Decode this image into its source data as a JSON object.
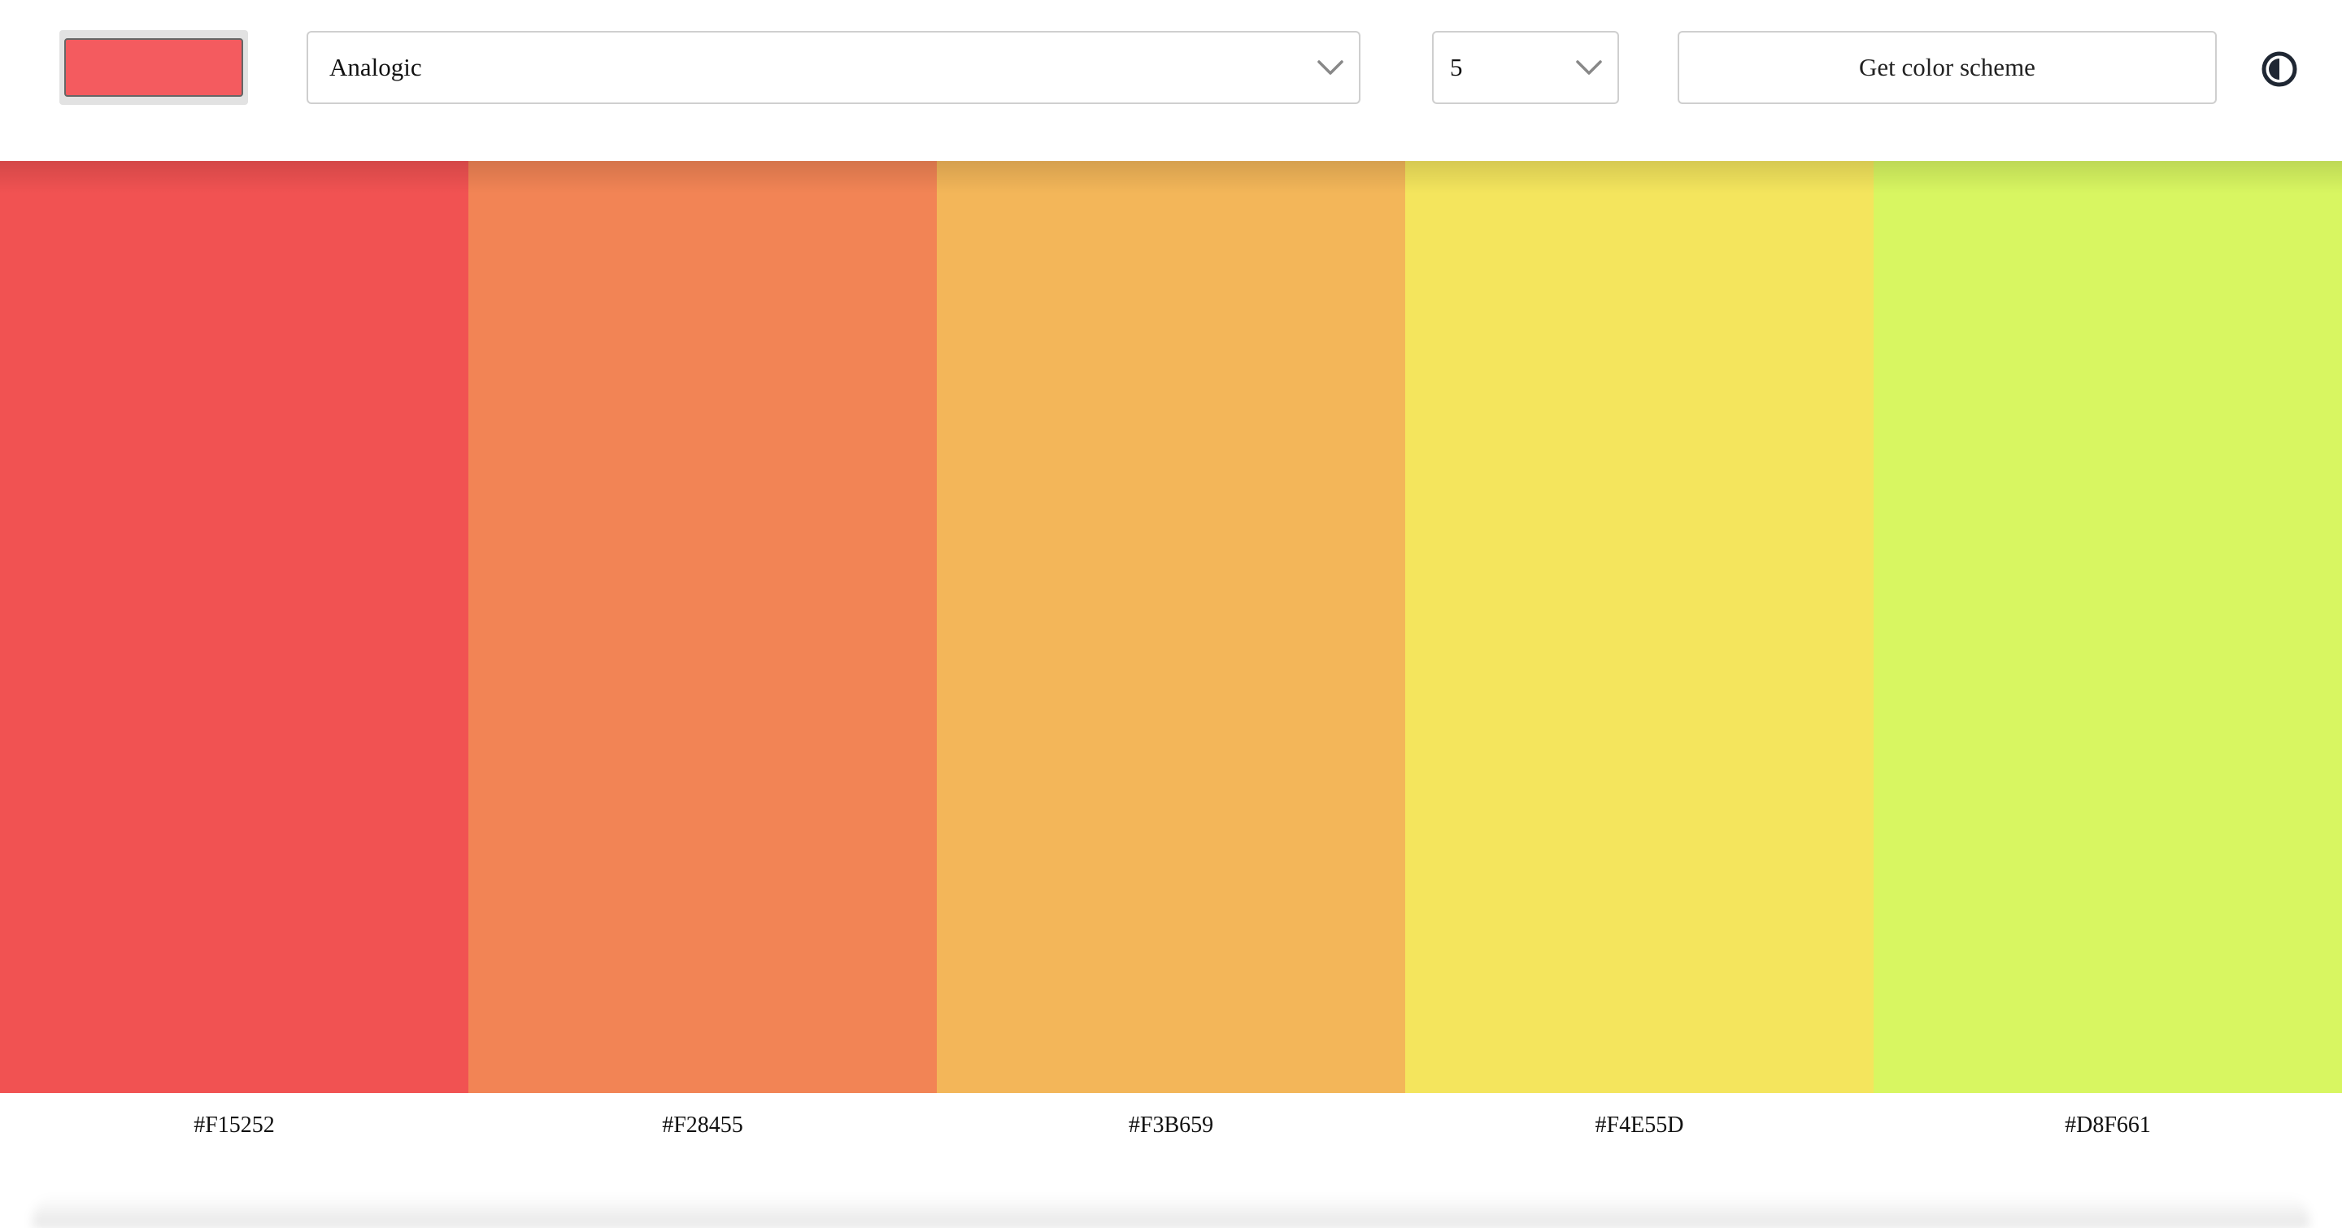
{
  "header": {
    "seed_color": "#F45B5F",
    "mode": {
      "selected": "Analogic",
      "icon": "chevron-down-icon"
    },
    "count": {
      "selected": "5",
      "icon": "chevron-down-icon"
    },
    "get_button_label": "Get color scheme",
    "theme_toggle_icon": "contrast-icon"
  },
  "palette": {
    "colors": [
      {
        "hex": "#F15252",
        "label": "#F15252"
      },
      {
        "hex": "#F28455",
        "label": "#F28455"
      },
      {
        "hex": "#F3B659",
        "label": "#F3B659"
      },
      {
        "hex": "#F4E55D",
        "label": "#F4E55D"
      },
      {
        "hex": "#D8F661",
        "label": "#D8F661"
      }
    ]
  }
}
